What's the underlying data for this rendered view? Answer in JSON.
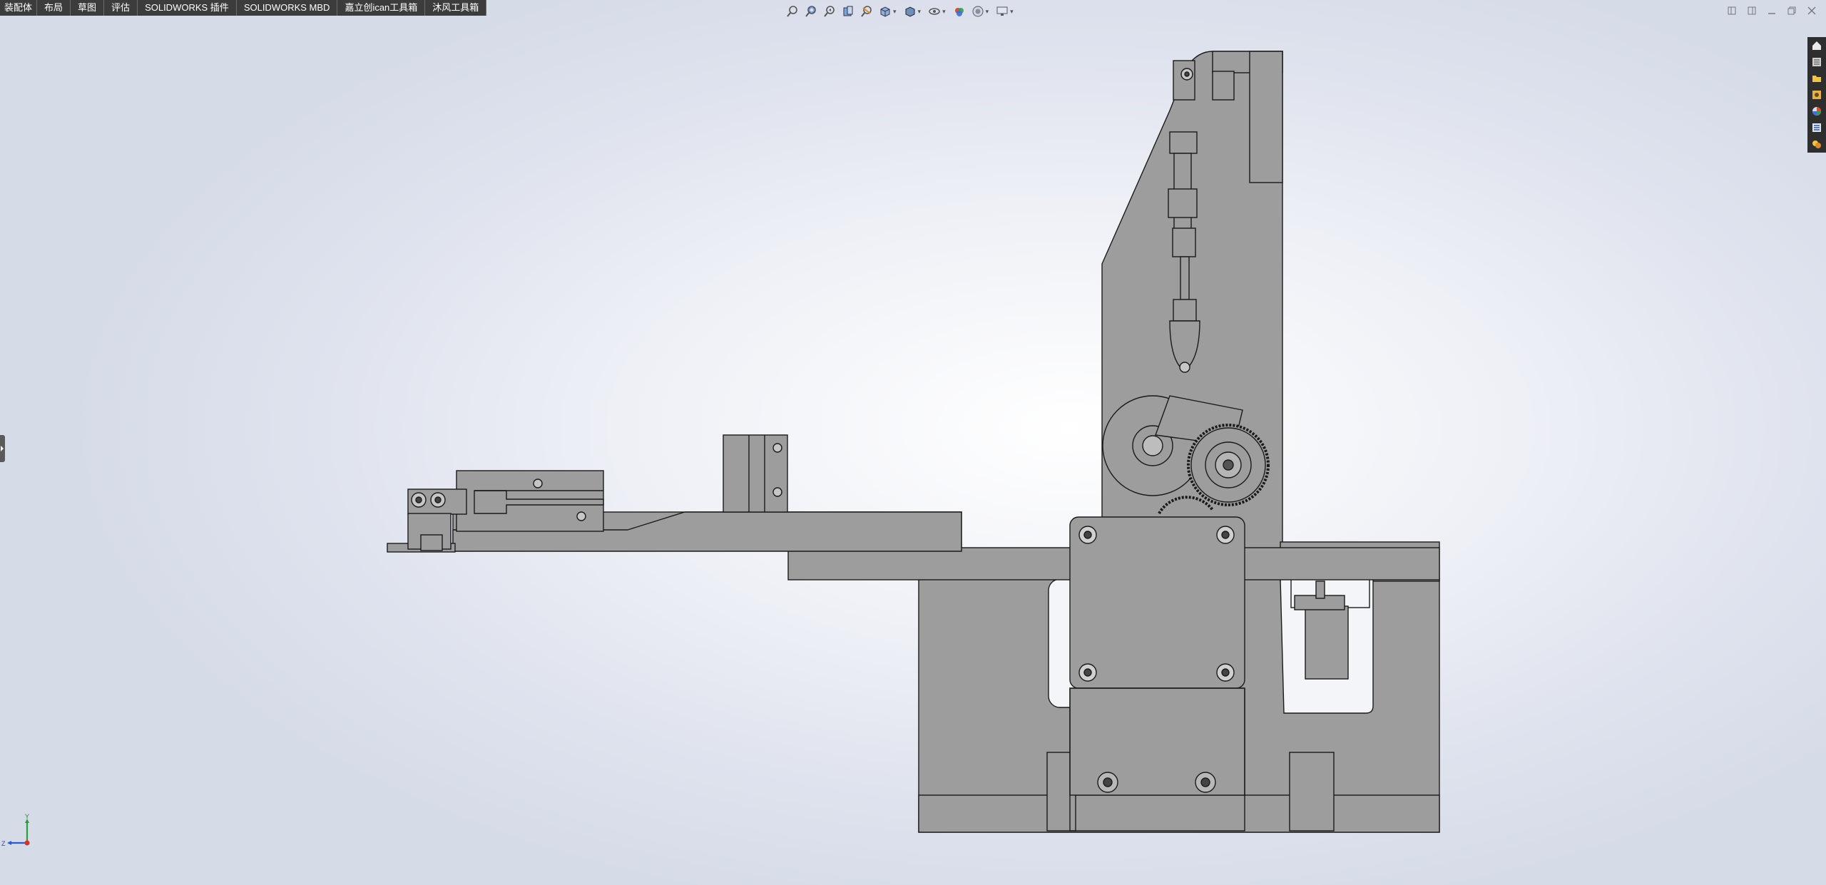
{
  "command_tabs": [
    "装配体",
    "布局",
    "草图",
    "评估",
    "SOLIDWORKS 插件",
    "SOLIDWORKS MBD",
    "嘉立创ican工具箱",
    "沐风工具箱"
  ],
  "view_toolbar": {
    "icons": [
      "zoom-to-fit-icon",
      "zoom-to-area-icon",
      "previous-view-icon",
      "section-view-icon",
      "dynamic-annotation-icon",
      "view-orientation-icon",
      "display-style-icon",
      "hide-show-items-icon",
      "edit-appearance-icon",
      "apply-scene-icon",
      "view-settings-icon"
    ]
  },
  "window_controls": [
    "tile-left-icon",
    "tile-right-icon",
    "minimize-icon",
    "restore-icon",
    "close-icon"
  ],
  "task_pane": [
    "home-icon",
    "resources-icon",
    "design-library-icon",
    "file-explorer-icon",
    "appearances-icon",
    "custom-properties-icon",
    "solidworks-forum-icon"
  ],
  "triad": {
    "y_label": "Y",
    "z_label": "Z"
  },
  "colors": {
    "part_fill": "#9d9d9d",
    "part_edge": "#1a1a1a",
    "tab_bg": "#3c3c3c",
    "taskpane_bg": "#2e2e2e"
  }
}
